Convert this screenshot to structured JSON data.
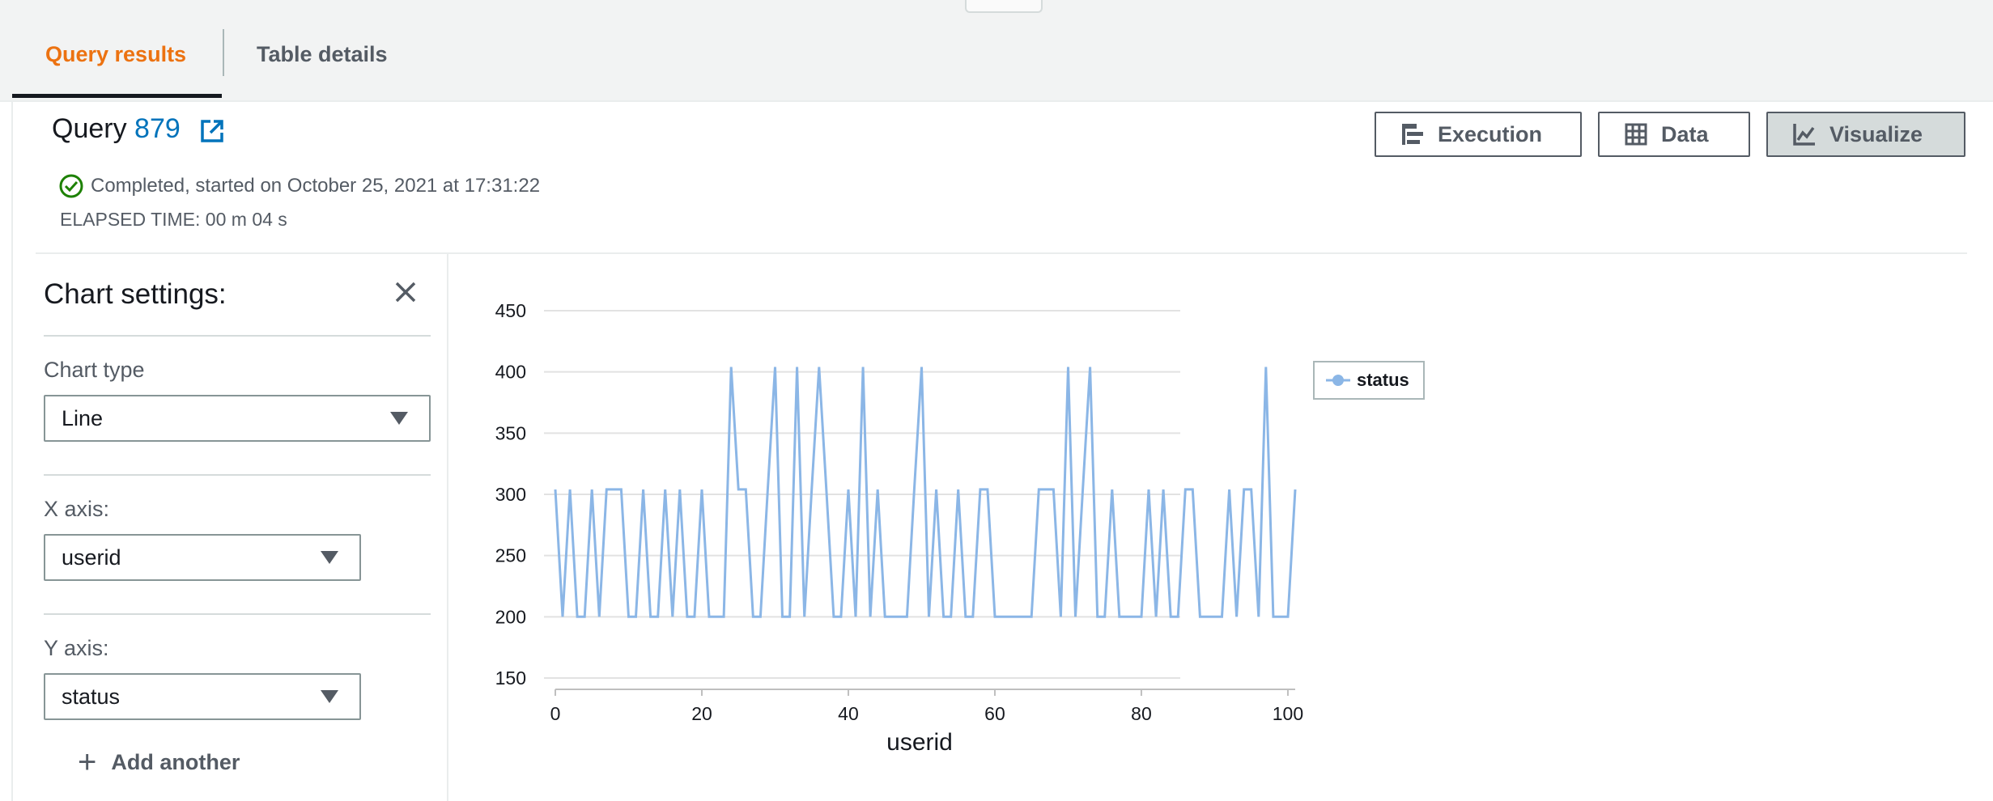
{
  "tabs": [
    {
      "label": "Query results",
      "active": true
    },
    {
      "label": "Table details",
      "active": false
    }
  ],
  "query": {
    "prefix": "Query",
    "id": "879",
    "status": "Completed, started on October 25, 2021 at 17:31:22",
    "elapsed": "ELAPSED TIME: 00 m 04 s"
  },
  "actions": {
    "execution": "Execution",
    "data": "Data",
    "visualize": "Visualize"
  },
  "settings": {
    "title": "Chart settings:",
    "chart_type_label": "Chart type",
    "chart_type_value": "Line",
    "x_axis_label": "X axis:",
    "x_axis_value": "userid",
    "y_axis_label": "Y axis:",
    "y_axis_value": "status",
    "add_another": "Add another"
  },
  "colors": {
    "accent": "#ec7211",
    "link": "#0073bb",
    "success": "#1d8102",
    "series": "#8bb6e6"
  },
  "icons": {
    "external": "external-link-icon",
    "status": "check-circle-icon",
    "execution": "execution-icon",
    "data": "table-icon",
    "visualize": "line-chart-icon",
    "close": "close-icon",
    "caret": "caret-down-icon",
    "add": "plus-icon"
  },
  "chart_data": {
    "type": "line",
    "xlabel": "userid",
    "ylabel": "",
    "xlim": [
      0,
      101
    ],
    "ylim": [
      150,
      450
    ],
    "x_ticks": [
      0,
      20,
      40,
      60,
      80,
      100
    ],
    "y_ticks": [
      150,
      200,
      250,
      300,
      350,
      400,
      450
    ],
    "grid": true,
    "legend": "right",
    "series": [
      {
        "name": "status",
        "x": [
          0,
          1,
          2,
          3,
          4,
          5,
          6,
          7,
          8,
          9,
          10,
          11,
          12,
          13,
          14,
          15,
          16,
          17,
          18,
          19,
          20,
          21,
          22,
          23,
          24,
          25,
          26,
          27,
          28,
          29,
          30,
          31,
          32,
          33,
          34,
          35,
          36,
          37,
          38,
          39,
          40,
          41,
          42,
          43,
          44,
          45,
          46,
          47,
          48,
          49,
          50,
          51,
          52,
          53,
          54,
          55,
          56,
          57,
          58,
          59,
          60,
          61,
          62,
          63,
          64,
          65,
          66,
          67,
          68,
          69,
          70,
          71,
          72,
          73,
          74,
          75,
          76,
          77,
          78,
          79,
          80,
          81,
          82,
          83,
          84,
          85,
          86,
          87,
          88,
          89,
          90,
          91,
          92,
          93,
          94,
          95,
          96,
          97,
          98,
          99,
          100,
          101
        ],
        "y": [
          304,
          200,
          304,
          200,
          200,
          304,
          200,
          304,
          304,
          304,
          200,
          200,
          304,
          200,
          200,
          304,
          200,
          304,
          200,
          200,
          304,
          200,
          200,
          200,
          404,
          304,
          304,
          200,
          200,
          304,
          404,
          200,
          200,
          404,
          200,
          304,
          404,
          304,
          200,
          200,
          304,
          200,
          404,
          200,
          304,
          200,
          200,
          200,
          200,
          304,
          404,
          200,
          304,
          200,
          200,
          304,
          200,
          200,
          304,
          304,
          200,
          200,
          200,
          200,
          200,
          200,
          304,
          304,
          304,
          200,
          404,
          200,
          304,
          404,
          200,
          200,
          304,
          200,
          200,
          200,
          200,
          304,
          200,
          304,
          200,
          200,
          304,
          304,
          200,
          200,
          200,
          200,
          304,
          200,
          304,
          304,
          200,
          404,
          200,
          200,
          200,
          304
        ]
      }
    ]
  }
}
